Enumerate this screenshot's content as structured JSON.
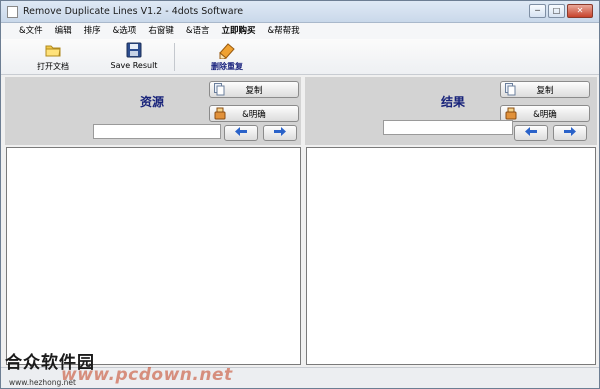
{
  "window": {
    "title": "Remove Duplicate Lines V1.2 - 4dots Software",
    "min_symbol": "─",
    "max_symbol": "□",
    "close_symbol": "✕"
  },
  "menu": [
    "&文件",
    "编辑",
    "排序",
    "&选项",
    "右窗键",
    "&语言",
    "立即购买",
    "&帮帮我"
  ],
  "toolbar": {
    "open_label": "打开文档",
    "save_label": "Save Result",
    "remove_label": "删除重复"
  },
  "source_pane": {
    "title": "资源",
    "copy_label": "复制",
    "clear_label": "&明确",
    "input_value": "",
    "text": ""
  },
  "result_pane": {
    "title": "结果",
    "copy_label": "复制",
    "clear_label": "&明确",
    "input_value": "",
    "text": ""
  },
  "watermark": {
    "left_text": "合众软件园",
    "left_site": "www.hezhong.net",
    "center_text": "www.pcdown.net"
  },
  "icons": {
    "app": "app-icon",
    "open": "folder-open-icon",
    "save": "floppy-disk-icon",
    "remove": "eraser-icon",
    "copy": "copy-icon",
    "clear": "clear-icon",
    "prev": "arrow-left-icon",
    "next": "arrow-right-icon"
  },
  "colors": {
    "pane_title": "#18237a",
    "pane_header_bg": "#d3d3d3",
    "arrow": "#2a62c9"
  }
}
